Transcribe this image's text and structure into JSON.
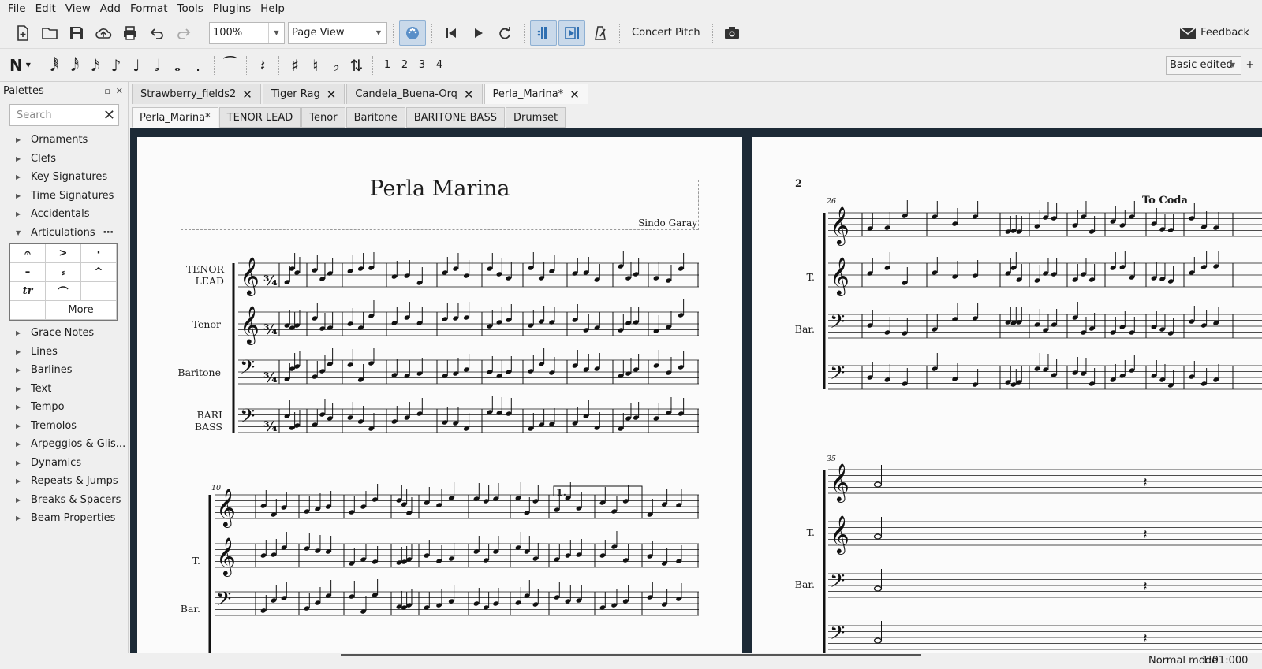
{
  "menu": [
    "File",
    "Edit",
    "View",
    "Add",
    "Format",
    "Tools",
    "Plugins",
    "Help"
  ],
  "toolbar": {
    "zoom": "100%",
    "view_mode": "Page View",
    "concert_pitch": "Concert Pitch",
    "feedback": "Feedback"
  },
  "note_toolbar": {
    "voices": [
      "1",
      "2",
      "3",
      "4"
    ],
    "workspace": "Basic edited",
    "add": "+"
  },
  "palettes": {
    "title": "Palettes",
    "search_placeholder": "Search",
    "items_top": [
      "Ornaments",
      "Clefs",
      "Key Signatures",
      "Time Signatures",
      "Accidentals",
      "Articulations"
    ],
    "more": "More",
    "items_bottom": [
      "Grace Notes",
      "Lines",
      "Barlines",
      "Text",
      "Tempo",
      "Tremolos",
      "Arpeggios & Glis...",
      "Dynamics",
      "Repeats & Jumps",
      "Breaks & Spacers",
      "Beam Properties"
    ],
    "articulation_cells": [
      "𝄐",
      ">",
      "·",
      "–",
      "⸗",
      "^",
      "tr",
      "⌒"
    ]
  },
  "doc_tabs": [
    "Strawberry_fields2",
    "Tiger Rag",
    "Candela_Buena-Orq",
    "Perla_Marina*"
  ],
  "part_tabs": [
    "Perla_Marina*",
    "TENOR LEAD",
    "Tenor",
    "Baritone",
    "BARITONE BASS",
    "Drumset"
  ],
  "score": {
    "title": "Perla Marina",
    "composer": "Sindo Garay",
    "page1": {
      "system1_instruments": [
        "TENOR LEAD",
        "Tenor",
        "Baritone",
        "BARI BASS"
      ],
      "system2_measure_number": "10",
      "system2_instruments": [
        "T.",
        "Bar."
      ],
      "volta": "1."
    },
    "page2": {
      "page_number": "2",
      "system1_measure_number": "26",
      "to_coda": "To Coda",
      "system1_instruments": [
        "T.",
        "Bar."
      ],
      "system2_measure_number": "35",
      "system2_instruments": [
        "T.",
        "Bar."
      ]
    }
  },
  "status": {
    "mode": "Normal mode",
    "position": "1:01:000"
  }
}
